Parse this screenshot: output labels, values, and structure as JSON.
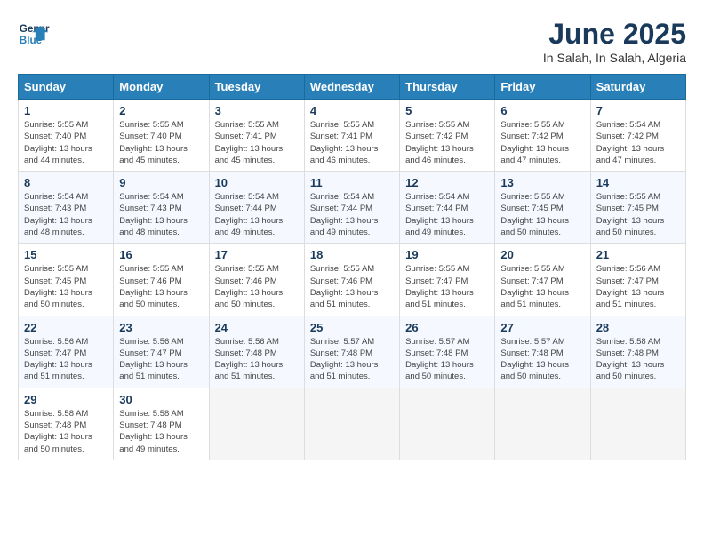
{
  "logo": {
    "line1": "General",
    "line2": "Blue"
  },
  "title": "June 2025",
  "location": "In Salah, In Salah, Algeria",
  "weekdays": [
    "Sunday",
    "Monday",
    "Tuesday",
    "Wednesday",
    "Thursday",
    "Friday",
    "Saturday"
  ],
  "weeks": [
    [
      {
        "day": "1",
        "text": "Sunrise: 5:55 AM\nSunset: 7:40 PM\nDaylight: 13 hours\nand 44 minutes."
      },
      {
        "day": "2",
        "text": "Sunrise: 5:55 AM\nSunset: 7:40 PM\nDaylight: 13 hours\nand 45 minutes."
      },
      {
        "day": "3",
        "text": "Sunrise: 5:55 AM\nSunset: 7:41 PM\nDaylight: 13 hours\nand 45 minutes."
      },
      {
        "day": "4",
        "text": "Sunrise: 5:55 AM\nSunset: 7:41 PM\nDaylight: 13 hours\nand 46 minutes."
      },
      {
        "day": "5",
        "text": "Sunrise: 5:55 AM\nSunset: 7:42 PM\nDaylight: 13 hours\nand 46 minutes."
      },
      {
        "day": "6",
        "text": "Sunrise: 5:55 AM\nSunset: 7:42 PM\nDaylight: 13 hours\nand 47 minutes."
      },
      {
        "day": "7",
        "text": "Sunrise: 5:54 AM\nSunset: 7:42 PM\nDaylight: 13 hours\nand 47 minutes."
      }
    ],
    [
      {
        "day": "8",
        "text": "Sunrise: 5:54 AM\nSunset: 7:43 PM\nDaylight: 13 hours\nand 48 minutes."
      },
      {
        "day": "9",
        "text": "Sunrise: 5:54 AM\nSunset: 7:43 PM\nDaylight: 13 hours\nand 48 minutes."
      },
      {
        "day": "10",
        "text": "Sunrise: 5:54 AM\nSunset: 7:44 PM\nDaylight: 13 hours\nand 49 minutes."
      },
      {
        "day": "11",
        "text": "Sunrise: 5:54 AM\nSunset: 7:44 PM\nDaylight: 13 hours\nand 49 minutes."
      },
      {
        "day": "12",
        "text": "Sunrise: 5:54 AM\nSunset: 7:44 PM\nDaylight: 13 hours\nand 49 minutes."
      },
      {
        "day": "13",
        "text": "Sunrise: 5:55 AM\nSunset: 7:45 PM\nDaylight: 13 hours\nand 50 minutes."
      },
      {
        "day": "14",
        "text": "Sunrise: 5:55 AM\nSunset: 7:45 PM\nDaylight: 13 hours\nand 50 minutes."
      }
    ],
    [
      {
        "day": "15",
        "text": "Sunrise: 5:55 AM\nSunset: 7:45 PM\nDaylight: 13 hours\nand 50 minutes."
      },
      {
        "day": "16",
        "text": "Sunrise: 5:55 AM\nSunset: 7:46 PM\nDaylight: 13 hours\nand 50 minutes."
      },
      {
        "day": "17",
        "text": "Sunrise: 5:55 AM\nSunset: 7:46 PM\nDaylight: 13 hours\nand 50 minutes."
      },
      {
        "day": "18",
        "text": "Sunrise: 5:55 AM\nSunset: 7:46 PM\nDaylight: 13 hours\nand 51 minutes."
      },
      {
        "day": "19",
        "text": "Sunrise: 5:55 AM\nSunset: 7:47 PM\nDaylight: 13 hours\nand 51 minutes."
      },
      {
        "day": "20",
        "text": "Sunrise: 5:55 AM\nSunset: 7:47 PM\nDaylight: 13 hours\nand 51 minutes."
      },
      {
        "day": "21",
        "text": "Sunrise: 5:56 AM\nSunset: 7:47 PM\nDaylight: 13 hours\nand 51 minutes."
      }
    ],
    [
      {
        "day": "22",
        "text": "Sunrise: 5:56 AM\nSunset: 7:47 PM\nDaylight: 13 hours\nand 51 minutes."
      },
      {
        "day": "23",
        "text": "Sunrise: 5:56 AM\nSunset: 7:47 PM\nDaylight: 13 hours\nand 51 minutes."
      },
      {
        "day": "24",
        "text": "Sunrise: 5:56 AM\nSunset: 7:48 PM\nDaylight: 13 hours\nand 51 minutes."
      },
      {
        "day": "25",
        "text": "Sunrise: 5:57 AM\nSunset: 7:48 PM\nDaylight: 13 hours\nand 51 minutes."
      },
      {
        "day": "26",
        "text": "Sunrise: 5:57 AM\nSunset: 7:48 PM\nDaylight: 13 hours\nand 50 minutes."
      },
      {
        "day": "27",
        "text": "Sunrise: 5:57 AM\nSunset: 7:48 PM\nDaylight: 13 hours\nand 50 minutes."
      },
      {
        "day": "28",
        "text": "Sunrise: 5:58 AM\nSunset: 7:48 PM\nDaylight: 13 hours\nand 50 minutes."
      }
    ],
    [
      {
        "day": "29",
        "text": "Sunrise: 5:58 AM\nSunset: 7:48 PM\nDaylight: 13 hours\nand 50 minutes."
      },
      {
        "day": "30",
        "text": "Sunrise: 5:58 AM\nSunset: 7:48 PM\nDaylight: 13 hours\nand 49 minutes."
      },
      {
        "day": "",
        "text": ""
      },
      {
        "day": "",
        "text": ""
      },
      {
        "day": "",
        "text": ""
      },
      {
        "day": "",
        "text": ""
      },
      {
        "day": "",
        "text": ""
      }
    ]
  ]
}
